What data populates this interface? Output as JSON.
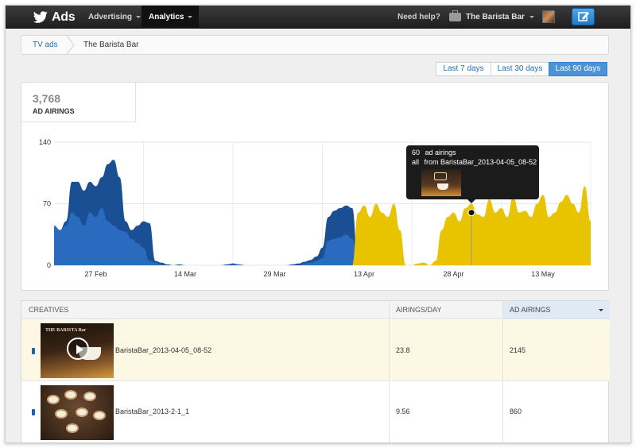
{
  "topbar": {
    "brand": "Ads",
    "nav": [
      "Advertising",
      "Analytics"
    ],
    "help": "Need help?",
    "account": "The Barista Bar"
  },
  "breadcrumb": {
    "root": "TV ads",
    "current": "The Barista Bar"
  },
  "ranges": {
    "items": [
      "Last 7 days",
      "Last 30 days",
      "Last 90 days"
    ],
    "selected": "Last 90 days"
  },
  "stat": {
    "value": "3,768",
    "label": "AD AIRINGS"
  },
  "tooltip": {
    "count": "60",
    "count_label": "ad airings",
    "scope": "all",
    "source": "from BaristaBar_2013-04-05_08-52"
  },
  "chart_data": {
    "type": "area",
    "ylim": [
      0,
      140
    ],
    "yticks": [
      "140",
      "70",
      "0"
    ],
    "xticks": [
      "27 Feb",
      "14 Mar",
      "29 Mar",
      "13 Apr",
      "28 Apr",
      "13 May"
    ],
    "x_start": "Feb 20",
    "series": [
      {
        "color": "#1a4f94",
        "values": [
          45,
          40,
          50,
          95,
          95,
          85,
          95,
          90,
          100,
          115,
          120,
          100,
          50,
          40,
          45,
          50,
          48,
          5,
          3,
          1,
          0,
          1,
          0,
          0,
          0,
          0,
          0,
          0,
          0,
          1,
          2,
          1,
          0,
          0,
          0,
          0,
          0,
          0,
          0,
          0,
          1,
          2,
          4,
          6,
          10,
          20,
          55,
          62,
          65,
          68,
          65,
          0,
          0,
          0,
          0,
          0,
          0,
          0,
          0,
          0,
          0,
          0,
          0,
          0,
          0,
          0,
          0,
          0,
          0,
          0,
          0,
          0,
          0,
          0,
          0,
          0,
          0,
          0,
          0,
          0,
          0,
          0,
          0,
          0,
          0,
          0,
          0,
          0,
          0,
          0,
          0
        ]
      },
      {
        "color": "#2a6bc0",
        "values": [
          45,
          40,
          45,
          60,
          55,
          45,
          60,
          55,
          65,
          50,
          45,
          40,
          38,
          30,
          25,
          20,
          5,
          3,
          1,
          0,
          0,
          0,
          0,
          0,
          0,
          0,
          0,
          0,
          0,
          0,
          1,
          1,
          0,
          0,
          0,
          0,
          0,
          0,
          0,
          0,
          0,
          0,
          2,
          3,
          5,
          8,
          28,
          30,
          32,
          35,
          30,
          0,
          0,
          0,
          0,
          0,
          0,
          0,
          0,
          0,
          0,
          0,
          0,
          0,
          0,
          0,
          0,
          0,
          0,
          0,
          0,
          0,
          0,
          0,
          0,
          0,
          0,
          0,
          0,
          0,
          0,
          0,
          0,
          0,
          0,
          0,
          0,
          0,
          0,
          0,
          0
        ]
      },
      {
        "color": "#e8c300",
        "values": [
          0,
          0,
          0,
          0,
          0,
          0,
          0,
          0,
          0,
          0,
          0,
          0,
          0,
          0,
          0,
          0,
          0,
          0,
          0,
          0,
          0,
          0,
          0,
          0,
          0,
          0,
          0,
          0,
          0,
          0,
          0,
          0,
          0,
          0,
          0,
          0,
          0,
          0,
          0,
          0,
          0,
          0,
          0,
          0,
          0,
          0,
          0,
          0,
          0,
          0,
          0,
          60,
          68,
          55,
          70,
          60,
          55,
          70,
          40,
          0,
          0,
          2,
          3,
          0,
          5,
          40,
          55,
          60,
          50,
          65,
          70,
          58,
          55,
          75,
          60,
          65,
          55,
          78,
          60,
          62,
          55,
          70,
          80,
          55,
          60,
          72,
          80,
          70,
          60,
          90,
          50
        ]
      }
    ],
    "marker_index": 70,
    "marker_value": 60
  },
  "table": {
    "headers": [
      "CREATIVES",
      "AIRINGS/DAY",
      "AD AIRINGS"
    ],
    "rows": [
      {
        "name": "BaristaBar_2013-04-05_08-52",
        "per_day": "23.8",
        "airings": "2145",
        "thumb_text": "THE BARISTA Bar"
      },
      {
        "name": "BaristaBar_2013-2-1_1",
        "per_day": "9.56",
        "airings": "860"
      }
    ]
  }
}
